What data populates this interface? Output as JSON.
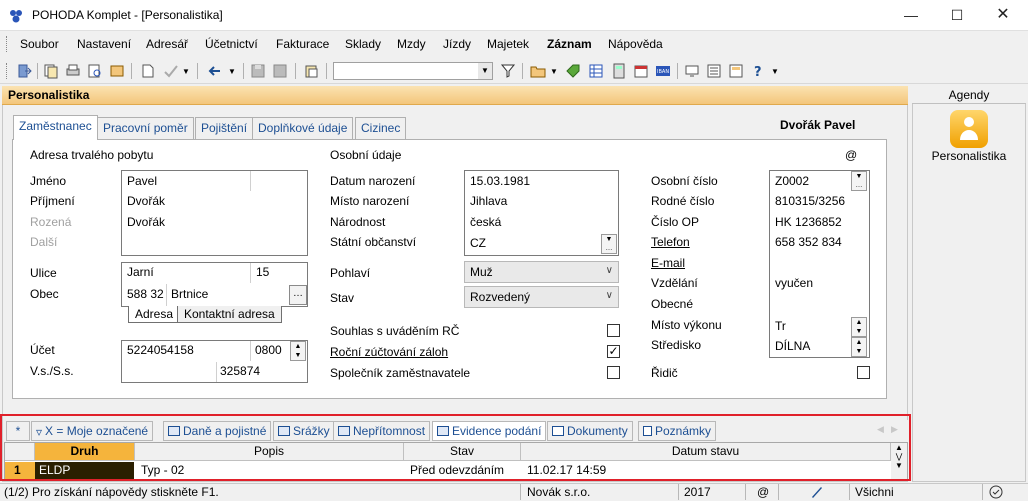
{
  "window": {
    "title": "POHODA Komplet - [Personalistika]",
    "min_icon": "minimize-icon",
    "max_icon": "maximize-icon",
    "close_icon": "close-icon"
  },
  "menu": [
    "Soubor",
    "Nastavení",
    "Adresář",
    "Účetnictví",
    "Fakturace",
    "Sklady",
    "Mzdy",
    "Jízdy",
    "Majetek",
    "Záznam",
    "Nápověda"
  ],
  "panel_title": "Personalistika",
  "tabs": [
    "Zaměstnanec",
    "Pracovní poměr",
    "Pojištění",
    "Doplňkové údaje",
    "Cizinec"
  ],
  "employee_name": "Dvořák Pavel",
  "address": {
    "heading": "Adresa trvalého pobytu",
    "labels": {
      "first": "Jméno",
      "last": "Příjmení",
      "birthname": "Rozená",
      "other": "Další",
      "street": "Ulice",
      "city": "Obec"
    },
    "first": "Pavel",
    "last": "Dvořák",
    "birthname": "Dvořák",
    "street": "Jarní",
    "house_no": "15",
    "zip": "588 32",
    "city": "Brtnice",
    "tab_address": "Adresa",
    "tab_contact": "Kontaktní adresa"
  },
  "account": {
    "labels": {
      "account": "Účet",
      "vs": "V.s./S.s."
    },
    "number": "5224054158",
    "bank": "0800",
    "ss": "325874"
  },
  "personal": {
    "heading": "Osobní údaje",
    "at": "@",
    "labels": {
      "birthdate": "Datum narození",
      "birthplace": "Místo narození",
      "nationality": "Národnost",
      "citizenship": "Státní občanství",
      "gender": "Pohlaví",
      "status": "Stav",
      "rc_consent": "Souhlas s uváděním RČ",
      "annual": "Roční zúčtování záloh",
      "partner": "Společník zaměstnavatele"
    },
    "birthdate": "15.03.1981",
    "birthplace": "Jihlava",
    "nationality": "česká",
    "citizenship": "CZ",
    "gender": "Muž",
    "status": "Rozvedený",
    "rc_consent": false,
    "annual": true,
    "partner": false
  },
  "right": {
    "labels": {
      "personal_no": "Osobní číslo",
      "birth_no": "Rodné číslo",
      "op": "Číslo OP",
      "phone": "Telefon",
      "email": "E-mail",
      "education": "Vzdělání",
      "general": "Obecné",
      "workplace": "Místo výkonu",
      "center": "Středisko",
      "driver": "Řidič"
    },
    "personal_no": "Z0002",
    "birth_no": "810315/3256",
    "op": "HK 1236852",
    "phone": "658 352 834",
    "education": "vyučen",
    "workplace": "Tr",
    "center": "DÍLNA",
    "driver": false
  },
  "bottom_tabs": [
    "*",
    "X = Moje označené",
    "Daně a pojistné",
    "Srážky",
    "Nepřítomnost",
    "Evidence podání",
    "Dokumenty",
    "Poznámky"
  ],
  "grid": {
    "headers": [
      "Druh",
      "Popis",
      "Stav",
      "Datum stavu"
    ],
    "rows": [
      {
        "index": "1",
        "druh": "ELDP",
        "popis": "Typ - 02",
        "stav": "Před odevzdáním",
        "datum": "11.02.17 14:59"
      }
    ]
  },
  "side": {
    "heading": "Agendy",
    "item": "Personalistika",
    "icon": "personalistika-icon"
  },
  "status": {
    "hint": "(1/2) Pro získání nápovědy stiskněte F1.",
    "company": "Novák s.r.o.",
    "year": "2017",
    "at": "@",
    "filter": "Všichni"
  },
  "colors": {
    "accent": "#f5b43c",
    "highlight_frame": "#e0202a",
    "tab_text": "#1d4f93"
  }
}
